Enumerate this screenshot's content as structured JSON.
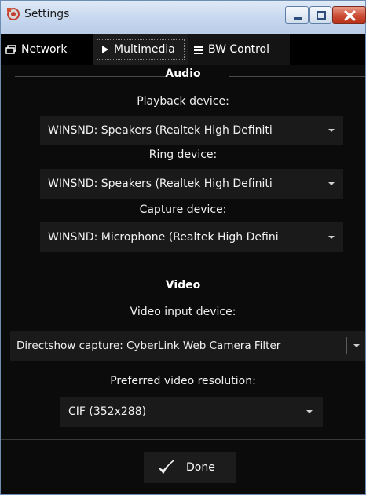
{
  "window": {
    "title": "Settings"
  },
  "tabs": [
    {
      "label": "Network",
      "icon": "window-icon"
    },
    {
      "label": "Multimedia",
      "icon": "play-icon"
    },
    {
      "label": "BW Control",
      "icon": "menu-lines-icon"
    }
  ],
  "audio": {
    "title": "Audio",
    "playback": {
      "label": "Playback device:",
      "value": "WINSND: Speakers (Realtek High Definiti"
    },
    "ring": {
      "label": "Ring device:",
      "value": "WINSND: Speakers (Realtek High Definiti"
    },
    "capture": {
      "label": "Capture device:",
      "value": "WINSND: Microphone (Realtek High Defini"
    }
  },
  "video": {
    "title": "Video",
    "input": {
      "label": "Video input device:",
      "value": "Directshow capture: CyberLink Web Camera Filter"
    },
    "resolution": {
      "label": "Preferred video resolution:",
      "value": "CIF (352x288)"
    }
  },
  "actions": {
    "done_label": "Done"
  },
  "colors": {
    "background": "#0b0b0b",
    "combo": "#1a1a1a",
    "close": "#c9452e"
  }
}
